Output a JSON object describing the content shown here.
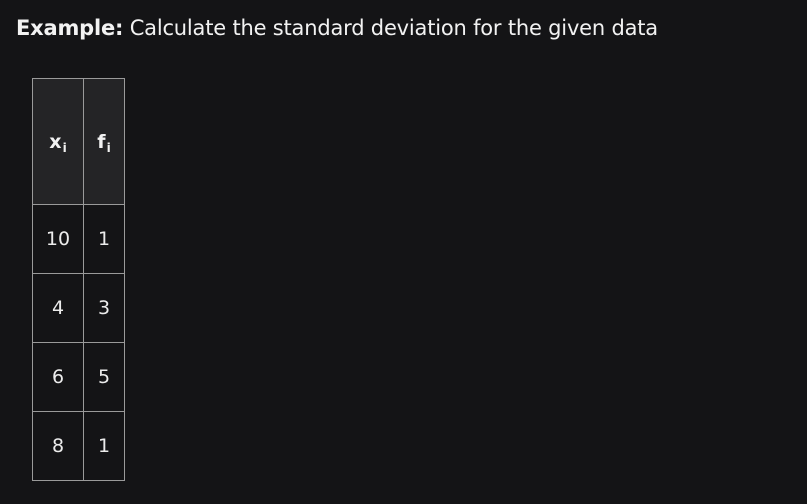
{
  "heading": {
    "label": "Example:",
    "text": " Calculate the standard deviation for the given data"
  },
  "table": {
    "headers": [
      {
        "var": "x",
        "sub": "i"
      },
      {
        "var": "f",
        "sub": "i"
      }
    ],
    "rows": [
      [
        "10",
        "1"
      ],
      [
        "4",
        "3"
      ],
      [
        "6",
        "5"
      ],
      [
        "8",
        "1"
      ]
    ]
  }
}
